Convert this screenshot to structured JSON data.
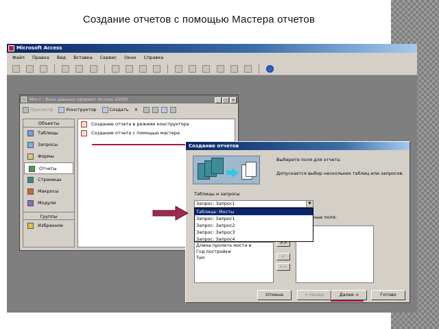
{
  "slide": {
    "title": "Создание отчетов с помощью Мастера отчетов"
  },
  "access": {
    "title": "Microsoft Access",
    "menu": [
      "Файл",
      "Правка",
      "Вид",
      "Вставка",
      "Сервис",
      "Окно",
      "Справка"
    ]
  },
  "db_window": {
    "title": "Мост : база данных (формат Access 2000)",
    "toolbar": {
      "preview": "Просмотр",
      "designer": "Конструктор",
      "create": "Создать"
    },
    "objects_header": "Объекты",
    "objects": [
      "Таблицы",
      "Запросы",
      "Формы",
      "Отчеты",
      "Страницы",
      "Макросы",
      "Модули"
    ],
    "groups_header": "Группы",
    "groups": [
      "Избранное"
    ],
    "list": [
      "Создание отчета в режиме конструктора",
      "Создание отчета с помощью мастера"
    ]
  },
  "wizard": {
    "title": "Создание отчетов",
    "prompt": "Выберите поля для отчета.",
    "hint": "Допускается выбор нескольких таблиц или запросов.",
    "source_label": "Таблицы и запросы",
    "source_value": "Запрос: Запрос1",
    "dropdown_options": [
      "Таблица: Мосты",
      "Запрос: Запрос1",
      "Запрос: Запрос2",
      "Запрос: Запрос3",
      "Запрос: Запрос4"
    ],
    "selected_fields_label": "ные поля:",
    "available_fields": [
      "Длина пролета моста и",
      "Год постройки",
      "Тип"
    ],
    "move_buttons": [
      ">>",
      "<",
      "<<"
    ],
    "buttons": {
      "cancel": "Отмена",
      "back": "< Назад",
      "next": "Далее >",
      "finish": "Готово"
    }
  }
}
